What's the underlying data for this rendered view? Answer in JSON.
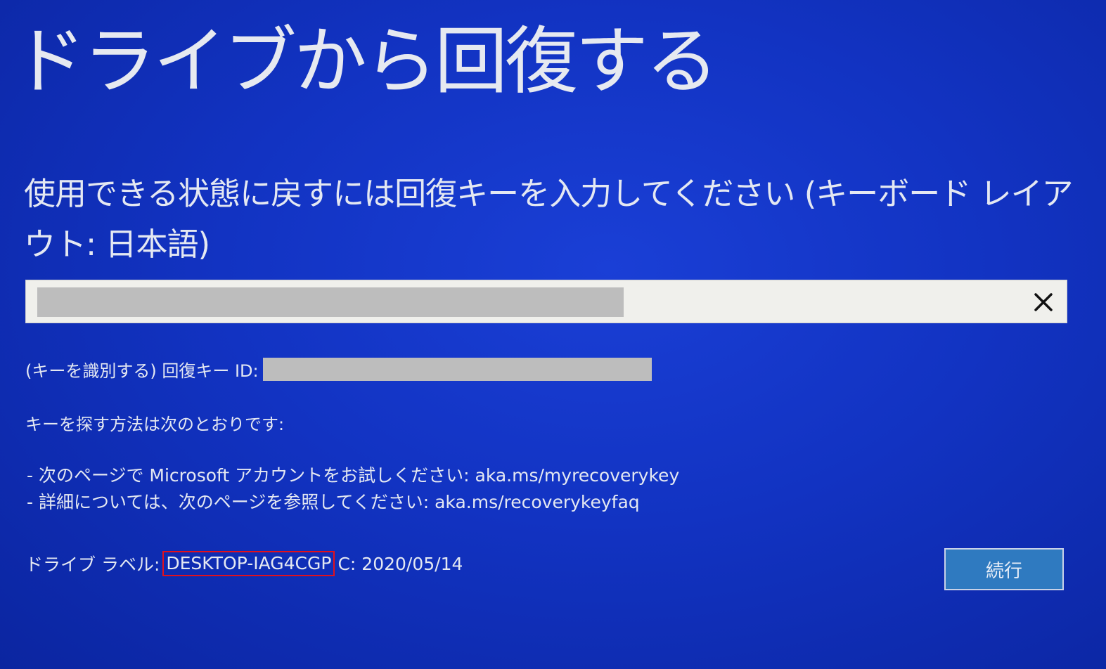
{
  "page": {
    "title": "ドライブから回復する",
    "instruction": "使用できる状態に戻すには回復キーを入力してください (キーボード レイアウト: 日本語)"
  },
  "recovery_key_input": {
    "value": "",
    "clear_icon": "close-icon"
  },
  "key_id": {
    "label": "(キーを識別する) 回復キー ID:",
    "value": ""
  },
  "help": {
    "heading": "キーを探す方法は次のとおりです:",
    "items": [
      "- 次のページで Microsoft アカウントをお試しください: aka.ms/myrecoverykey",
      "- 詳細については、次のページを参照してください: aka.ms/recoverykeyfaq"
    ]
  },
  "drive": {
    "label": "ドライブ ラベル:",
    "name": "DESKTOP-IAG4CGP",
    "info": "C: 2020/05/14"
  },
  "buttons": {
    "continue_label": "続行"
  },
  "colors": {
    "background": "#1233c2",
    "input_background": "#f0f0ec",
    "redacted": "#bdbdbd",
    "highlight": "#e3101c",
    "button": "#2f7ac0"
  }
}
